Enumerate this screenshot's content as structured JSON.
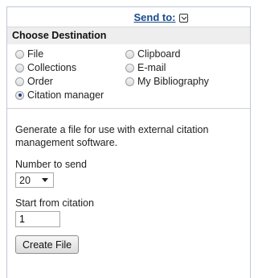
{
  "header": {
    "send_to_label": "Send to:"
  },
  "destination": {
    "title": "Choose Destination",
    "options": [
      {
        "label": "File",
        "selected": false
      },
      {
        "label": "Clipboard",
        "selected": false
      },
      {
        "label": "Collections",
        "selected": false
      },
      {
        "label": "E-mail",
        "selected": false
      },
      {
        "label": "Order",
        "selected": false
      },
      {
        "label": "My Bibliography",
        "selected": false
      },
      {
        "label": "Citation manager",
        "selected": true
      }
    ]
  },
  "citation": {
    "description": "Generate a file for use with external citation management software.",
    "number_label": "Number to send",
    "number_value": "20",
    "start_label": "Start from citation",
    "start_value": "1",
    "button_label": "Create File"
  }
}
